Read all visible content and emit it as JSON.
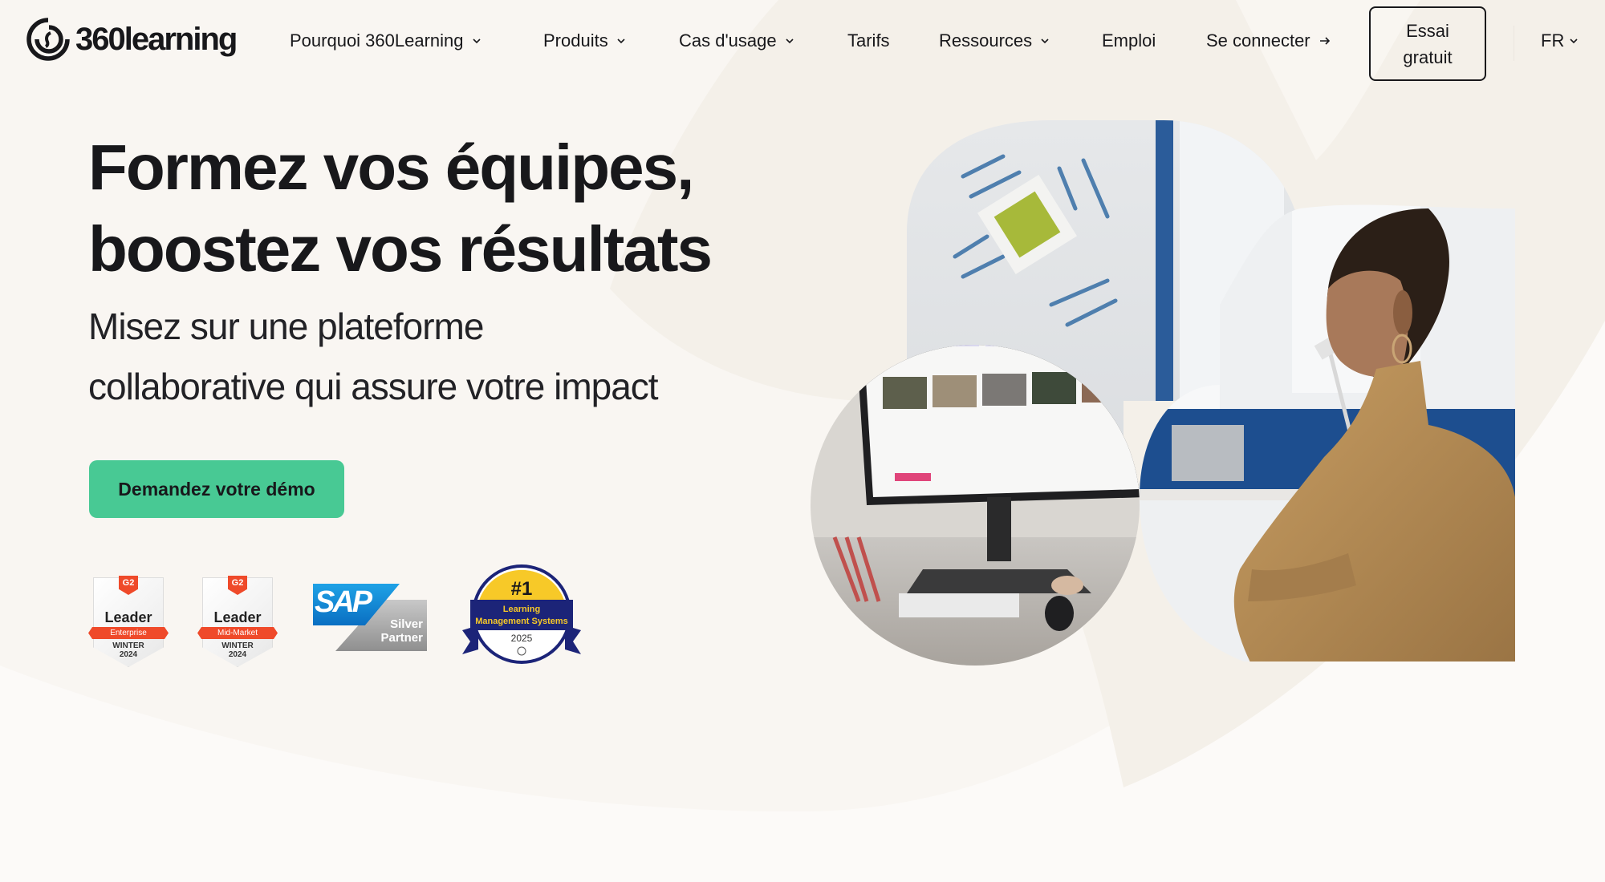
{
  "brand": {
    "name": "360learning",
    "colors": {
      "background": "#fcfaf8",
      "cream": "#f4f0e9",
      "accent_green": "#48c994",
      "text": "#18181b"
    }
  },
  "nav": {
    "items": [
      {
        "label": "Pourquoi 360Learning",
        "has_dropdown": true
      },
      {
        "label": "Produits",
        "has_dropdown": true
      },
      {
        "label": "Cas d'usage",
        "has_dropdown": true
      },
      {
        "label": "Tarifs",
        "has_dropdown": false
      },
      {
        "label": "Ressources",
        "has_dropdown": true
      },
      {
        "label": "Emploi",
        "has_dropdown": false
      }
    ],
    "login": {
      "label": "Se connecter",
      "icon": "arrow-right-icon"
    },
    "trial": {
      "line1": "Essai",
      "line2": "gratuit"
    },
    "language": {
      "label": "FR",
      "icon": "chevron-down-icon"
    }
  },
  "hero": {
    "title_line1": "Formez vos équipes,",
    "title_line2": "boostez vos résultats",
    "subtitle_line1": "Misez sur une plateforme",
    "subtitle_line2": "collaborative qui assure votre impact",
    "cta_label": "Demandez votre démo"
  },
  "badges": [
    {
      "type": "g2",
      "logo": "G2",
      "title": "Leader",
      "segment": "Enterprise",
      "season": "WINTER",
      "year": "2024"
    },
    {
      "type": "g2",
      "logo": "G2",
      "title": "Leader",
      "segment": "Mid-Market",
      "season": "WINTER",
      "year": "2024"
    },
    {
      "type": "sap",
      "brand": "SAP",
      "line1": "Silver",
      "line2": "Partner",
      "tm": "™"
    },
    {
      "type": "elearning",
      "rank": "#1",
      "line1": "Learning",
      "line2": "Management Systems",
      "year": "2025"
    }
  ],
  "images": {
    "collage": "office worker at desk with monitor showing learning platform"
  }
}
